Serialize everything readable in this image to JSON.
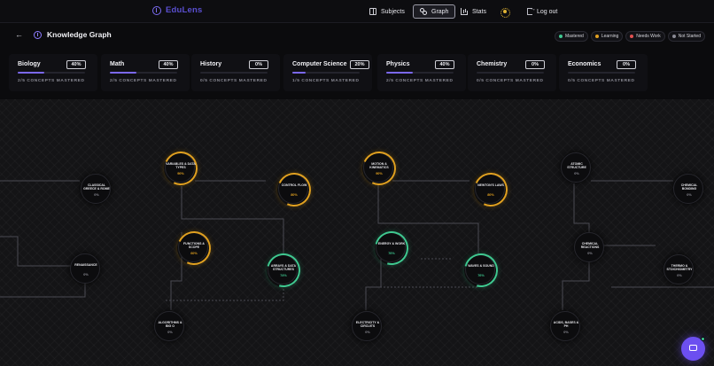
{
  "app": {
    "brand": "EduLens"
  },
  "nav": {
    "subjects": "Subjects",
    "graph": "Graph",
    "stats": "Stats",
    "logout": "Log out"
  },
  "header": {
    "back": "←",
    "title": "Knowledge Graph",
    "legend": [
      {
        "label": "Mastered",
        "color": "#3fc890"
      },
      {
        "label": "Learning",
        "color": "#e0a020"
      },
      {
        "label": "Needs Work",
        "color": "#e05050"
      },
      {
        "label": "Not Started",
        "color": "#8a8a94"
      }
    ]
  },
  "subjects": [
    {
      "name": "Biology",
      "pct": "40%",
      "progress": 0.4,
      "mastered": "2/5 CONCEPTS MASTERED"
    },
    {
      "name": "Math",
      "pct": "40%",
      "progress": 0.4,
      "mastered": "2/5 CONCEPTS MASTERED"
    },
    {
      "name": "History",
      "pct": "0%",
      "progress": 0,
      "mastered": "0/5 CONCEPTS MASTERED"
    },
    {
      "name": "Computer Science",
      "pct": "20%",
      "progress": 0.2,
      "mastered": "1/5 CONCEPTS MASTERED"
    },
    {
      "name": "Physics",
      "pct": "40%",
      "progress": 0.4,
      "mastered": "2/5 CONCEPTS MASTERED"
    },
    {
      "name": "Chemistry",
      "pct": "0%",
      "progress": 0,
      "mastered": "0/5 CONCEPTS MASTERED"
    },
    {
      "name": "Economics",
      "pct": "0%",
      "progress": 0,
      "mastered": "0/5 CONCEPTS MASTERED"
    }
  ],
  "graph": {
    "nodes": [
      {
        "id": "classical",
        "label": "CLASSICAL GREECE & ROME",
        "pct": "0%",
        "status": "not-started"
      },
      {
        "id": "renaissance",
        "label": "RENAISSANCE",
        "pct": "0%",
        "status": "not-started"
      },
      {
        "id": "variables",
        "label": "VARIABLES & DATA TYPES",
        "pct": "90%",
        "status": "learning"
      },
      {
        "id": "control-flow",
        "label": "CONTROL FLOW",
        "pct": "80%",
        "status": "learning"
      },
      {
        "id": "functions",
        "label": "FUNCTIONS & SCOPE",
        "pct": "60%",
        "status": "learning"
      },
      {
        "id": "arrays",
        "label": "ARRAYS & DATA STRUCTURES",
        "pct": "74%",
        "status": "mastered"
      },
      {
        "id": "algorithms",
        "label": "ALGORITHMS & BIG O",
        "pct": "0%",
        "status": "not-started"
      },
      {
        "id": "kinematics",
        "label": "MOTION & KINEMATICS",
        "pct": "90%",
        "status": "learning"
      },
      {
        "id": "newtons",
        "label": "NEWTON'S LAWS",
        "pct": "80%",
        "status": "learning"
      },
      {
        "id": "energy",
        "label": "ENERGY & WORK",
        "pct": "76%",
        "status": "mastered"
      },
      {
        "id": "waves",
        "label": "WAVES & SOUND",
        "pct": "76%",
        "status": "mastered"
      },
      {
        "id": "electricity",
        "label": "ELECTRICITY & CIRCUITS",
        "pct": "0%",
        "status": "not-started"
      },
      {
        "id": "atomic",
        "label": "ATOMIC STRUCTURE",
        "pct": "0%",
        "status": "not-started"
      },
      {
        "id": "bonding",
        "label": "CHEMICAL BONDING",
        "pct": "0%",
        "status": "not-started"
      },
      {
        "id": "reactions",
        "label": "CHEMICAL REACTIONS",
        "pct": "0%",
        "status": "not-started"
      },
      {
        "id": "stoichiometry",
        "label": "THERMO & STOICHIOMETRY",
        "pct": "0%",
        "status": "not-started"
      },
      {
        "id": "acids",
        "label": "ACIDS, BASES & PH",
        "pct": "0%",
        "status": "not-started"
      }
    ]
  }
}
